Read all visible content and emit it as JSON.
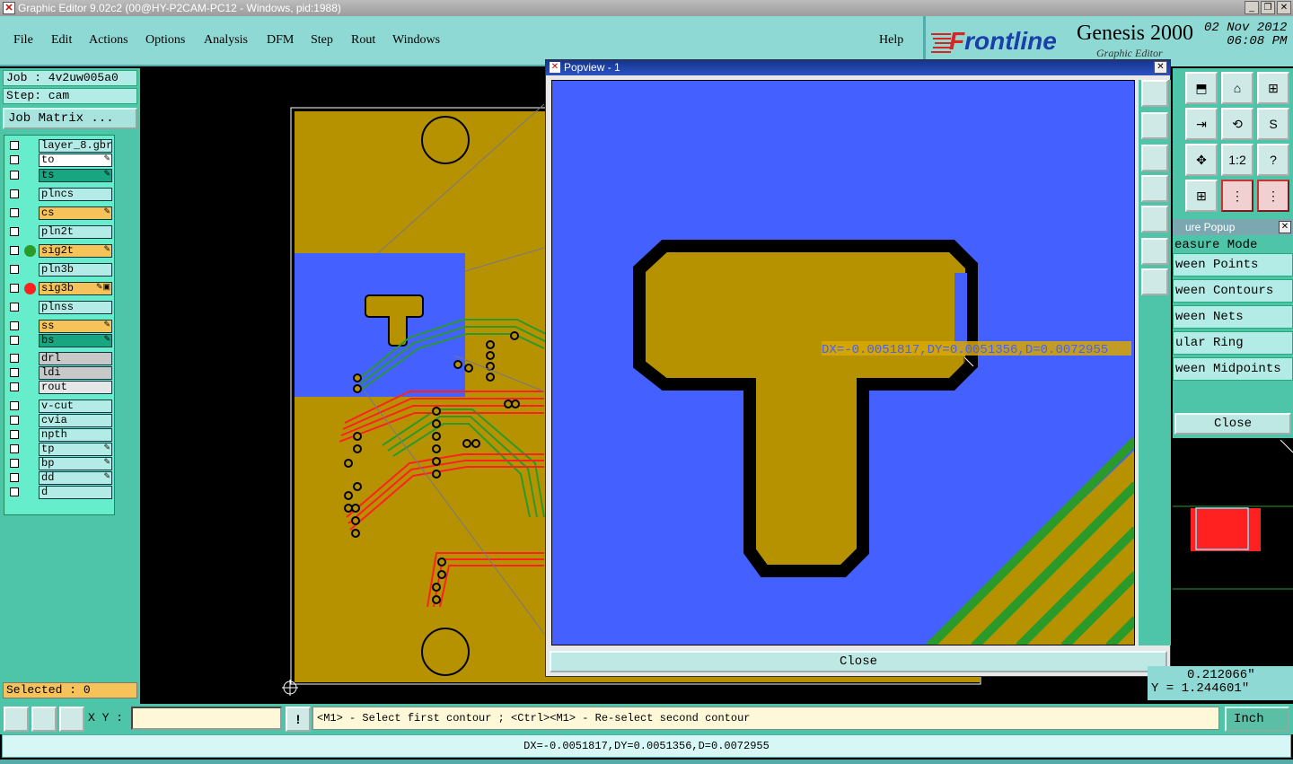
{
  "window": {
    "title": "Graphic Editor 9.02c2 (00@HY-P2CAM-PC12 - Windows, pid:1988)"
  },
  "menu": [
    "File",
    "Edit",
    "Actions",
    "Options",
    "Analysis",
    "DFM",
    "Step",
    "Rout",
    "Windows"
  ],
  "help": "Help",
  "brand": {
    "logo_f": "F",
    "logo_rest": "rontline",
    "product": "Genesis 2000",
    "subtitle": "Graphic Editor",
    "date": "02 Nov 2012",
    "time": "06:08 PM"
  },
  "job": {
    "job": "Job : 4v2uw005a0",
    "step": "Step: cam",
    "matrix": "Job Matrix ..."
  },
  "layers": [
    {
      "name": "layer_8.gbr",
      "color": "#b3ece6",
      "dot": ""
    },
    {
      "name": "to",
      "color": "#ffffff",
      "dot": "",
      "icon": "✎"
    },
    {
      "name": "ts",
      "color": "#17a67f",
      "dot": "",
      "icon": "✎"
    },
    {
      "name": "plncs",
      "color": "#b3ece6",
      "dot": ""
    },
    {
      "name": "cs",
      "color": "#f6c35b",
      "dot": "",
      "icon": "✎"
    },
    {
      "name": "pln2t",
      "color": "#b3ece6",
      "dot": ""
    },
    {
      "name": "sig2t",
      "color": "#f6c35b",
      "dot": "#2a9a2a",
      "icon": "✎"
    },
    {
      "name": "pln3b",
      "color": "#b3ece6",
      "dot": ""
    },
    {
      "name": "sig3b",
      "color": "#f6c35b",
      "dot": "#ff2020",
      "icon": "✎▣"
    },
    {
      "name": "plnss",
      "color": "#b3ece6",
      "dot": ""
    },
    {
      "name": "ss",
      "color": "#f6c35b",
      "dot": "",
      "icon": "✎"
    },
    {
      "name": "bs",
      "color": "#17a67f",
      "dot": "",
      "icon": "✎"
    },
    {
      "name": "drl",
      "color": "#c8c8c8",
      "dot": ""
    },
    {
      "name": "ldi",
      "color": "#c8c8c8",
      "dot": ""
    },
    {
      "name": "rout",
      "color": "#e6e6e6",
      "dot": ""
    },
    {
      "name": "v-cut",
      "color": "#b3ece6",
      "dot": ""
    },
    {
      "name": "cvia",
      "color": "#b3ece6",
      "dot": ""
    },
    {
      "name": "npth",
      "color": "#b3ece6",
      "dot": ""
    },
    {
      "name": "tp",
      "color": "#b3ece6",
      "dot": "",
      "icon": "✎"
    },
    {
      "name": "bp",
      "color": "#b3ece6",
      "dot": "",
      "icon": "✎"
    },
    {
      "name": "dd",
      "color": "#b3ece6",
      "dot": "",
      "icon": "✎"
    },
    {
      "name": "d",
      "color": "#b3ece6",
      "dot": ""
    }
  ],
  "selected": "Selected : 0",
  "popview": {
    "title": "Popview - 1",
    "measure_text": "DX=-0.0051817,DY=0.0051356,D=0.0072955",
    "close": "Close"
  },
  "measure_popup": {
    "title": "ure Popup",
    "mode": "easure Mode",
    "items": [
      "ween Points",
      "ween Contours",
      "ween Nets",
      "ular Ring",
      "ween Midpoints"
    ],
    "close": "Close"
  },
  "icon_labels": {
    "ratio": "1:2",
    "help": "?"
  },
  "coords": {
    "x": "0.212066\"",
    "y": "Y = 1.244601\""
  },
  "xy_label": "X Y :",
  "prompt": "<M1> - Select first contour ; <Ctrl><M1> - Re-select second contour",
  "units": "Inch",
  "status": "DX=-0.0051817,DY=0.0051356,D=0.0072955",
  "colors": {
    "board": "#b79200",
    "substrate": "#4461ff",
    "trace_red": "#ff2020",
    "trace_green": "#2a9a2a",
    "panel": "#4ec4a8"
  }
}
